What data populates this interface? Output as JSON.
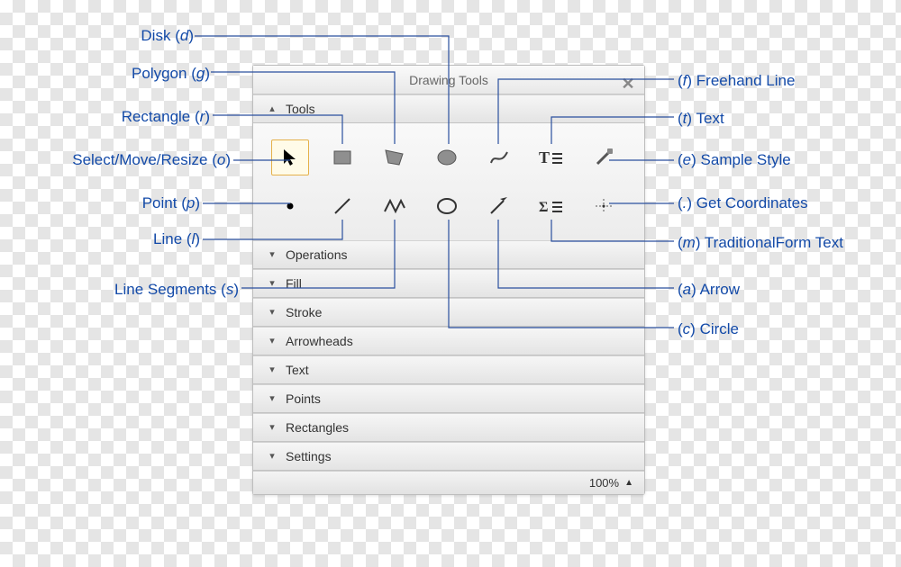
{
  "panel": {
    "title": "Drawing Tools",
    "zoom": "100%",
    "sections": {
      "tools": "Tools",
      "operations": "Operations",
      "fill": "Fill",
      "stroke": "Stroke",
      "arrowheads": "Arrowheads",
      "text": "Text",
      "points": "Points",
      "rectangles": "Rectangles",
      "settings": "Settings"
    }
  },
  "tools": {
    "select": {
      "name": "Select/Move/Resize",
      "shortcut": "o"
    },
    "rectangle": {
      "name": "Rectangle",
      "shortcut": "r"
    },
    "polygon": {
      "name": "Polygon",
      "shortcut": "g"
    },
    "disk": {
      "name": "Disk",
      "shortcut": "d"
    },
    "freehand": {
      "name": "Freehand Line",
      "shortcut": "f"
    },
    "text": {
      "name": "Text",
      "shortcut": "t"
    },
    "sampleStyle": {
      "name": "Sample Style",
      "shortcut": "e"
    },
    "point": {
      "name": "Point",
      "shortcut": "p"
    },
    "line": {
      "name": "Line",
      "shortcut": "l"
    },
    "lineSegments": {
      "name": "Line Segments",
      "shortcut": "s"
    },
    "circle": {
      "name": "Circle",
      "shortcut": "c"
    },
    "arrow": {
      "name": "Arrow",
      "shortcut": "a"
    },
    "tradFormText": {
      "name": "TraditionalForm Text",
      "shortcut": "m"
    },
    "getCoords": {
      "name": "Get Coordinates",
      "shortcut": "."
    }
  },
  "labels": {
    "left": [
      {
        "id": "disk",
        "text": "Disk",
        "key": "d"
      },
      {
        "id": "polygon",
        "text": "Polygon",
        "key": "g"
      },
      {
        "id": "rectangle",
        "text": "Rectangle",
        "key": "r"
      },
      {
        "id": "select",
        "text": "Select/Move/Resize",
        "key": "o"
      },
      {
        "id": "point",
        "text": "Point",
        "key": "p"
      },
      {
        "id": "line",
        "text": "Line",
        "key": "l"
      },
      {
        "id": "segments",
        "text": "Line Segments",
        "key": "s"
      }
    ],
    "right": [
      {
        "id": "freehand",
        "text": "Freehand Line",
        "key": "f"
      },
      {
        "id": "text",
        "text": "Text",
        "key": "t"
      },
      {
        "id": "sample",
        "text": "Sample Style",
        "key": "e"
      },
      {
        "id": "coords",
        "text": "Get Coordinates",
        "key": "."
      },
      {
        "id": "tradform",
        "text": "TraditionalForm Text",
        "key": "m"
      },
      {
        "id": "arrow",
        "text": "Arrow",
        "key": "a"
      },
      {
        "id": "circle",
        "text": "Circle",
        "key": "c"
      }
    ]
  }
}
